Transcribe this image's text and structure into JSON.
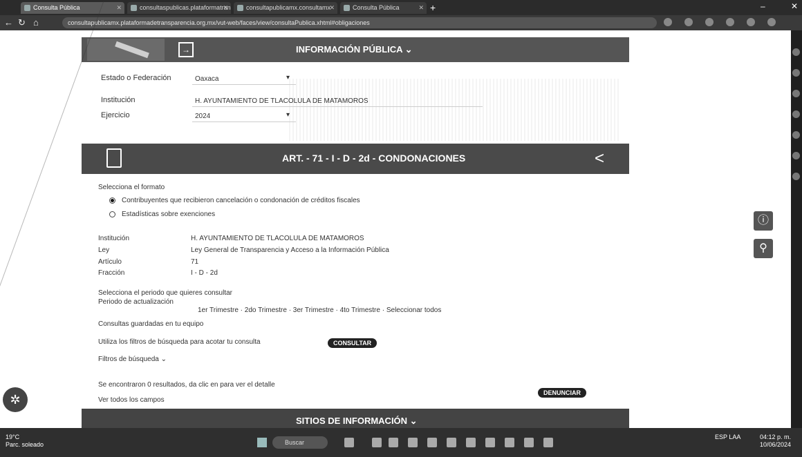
{
  "browser": {
    "tabs": [
      {
        "label": "Consulta Pública"
      },
      {
        "label": "consultaspublicas.plataformatransparencia.org.mx"
      },
      {
        "label": "consultapublicamx.consultamx"
      },
      {
        "label": "Consulta Pública"
      }
    ],
    "new_tab": "+",
    "url": "consultapublicamx.plataformadetransparencia.org.mx/vut-web/faces/view/consultaPublica.xhtml#obligaciones"
  },
  "header": {
    "title": "INFORMACIÓN PÚBLICA ⌄"
  },
  "filters": {
    "estado_label": "Estado o Federación",
    "estado_value": "Oaxaca",
    "institucion_label": "Institución",
    "institucion_value": "H. AYUNTAMIENTO DE TLACOLULA DE MATAMOROS",
    "ejercicio_label": "Ejercicio",
    "ejercicio_value": "2024"
  },
  "article": {
    "title": "ART. - 71 - I - D - 2d - CONDONACIONES"
  },
  "formato": {
    "prompt": "Selecciona el formato",
    "options": [
      {
        "label": "Contribuyentes que recibieron cancelación o condonación de créditos fiscales",
        "selected": true
      },
      {
        "label": "Estadísticas sobre exenciones",
        "selected": false
      }
    ]
  },
  "details": {
    "institucion_label": "Institución",
    "institucion_value": "H. AYUNTAMIENTO DE TLACOLULA DE MATAMOROS",
    "ley_label": "Ley",
    "ley_value": "Ley General de Transparencia y Acceso a la Información Pública",
    "articulo_label": "Artículo",
    "articulo_value": "71",
    "fraccion_label": "Fracción",
    "fraccion_value": "I - D - 2d"
  },
  "periodo": {
    "prompt": "Selecciona el periodo que quieres consultar",
    "label": "Periodo de actualización",
    "value": "1er Trimestre · 2do Trimestre · 3er Trimestre · 4to Trimestre · Seleccionar todos"
  },
  "links": {
    "consulta_guardada": "Consultas guardadas en tu equipo",
    "filtros_prompt": "Utiliza los filtros de búsqueda para acotar tu consulta",
    "consultar_button": "CONSULTAR",
    "filtros_busqueda": "Filtros de búsqueda ⌄",
    "resultados_text": "Se encontraron 0 resultados, da clic en  para ver el detalle",
    "denunciar_button": "DENUNCIAR",
    "ver_campos": "Ver todos los campos"
  },
  "footer_band": {
    "title": "SITIOS DE INFORMACIÓN ⌄"
  },
  "taskbar": {
    "weather_temp": "19°C",
    "weather_desc": "Parc. soleado",
    "search_placeholder": "Buscar",
    "lang": "ESP LAA",
    "time": "04:12 p. m.",
    "date": "10/06/2024"
  }
}
